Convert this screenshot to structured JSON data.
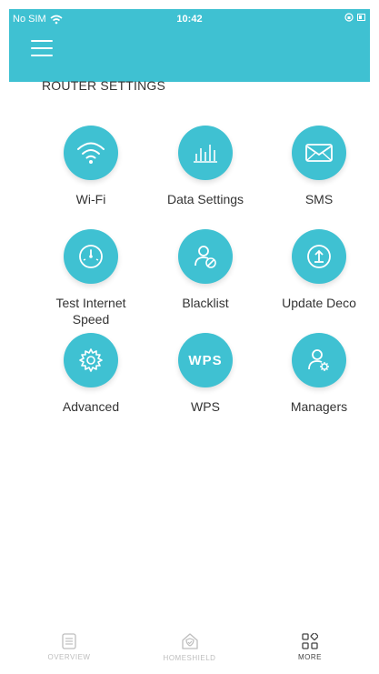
{
  "theme": {
    "accent": "#3fc1d2"
  },
  "status_bar": {
    "carrier": "No SIM",
    "time": "10:42"
  },
  "section_title": "ROUTER SETTINGS",
  "tiles": [
    {
      "label": "Wi-Fi",
      "icon": "wifi-icon"
    },
    {
      "label": "Data Settings",
      "icon": "bar-chart-icon"
    },
    {
      "label": "SMS",
      "icon": "envelope-icon"
    },
    {
      "label": "Test Internet Speed",
      "icon": "speedometer-icon"
    },
    {
      "label": "Blacklist",
      "icon": "user-blocked-icon"
    },
    {
      "label": "Update Deco",
      "icon": "upload-icon"
    },
    {
      "label": "Advanced",
      "icon": "gear-icon"
    },
    {
      "label": "WPS",
      "icon": "wps-icon"
    },
    {
      "label": "Managers",
      "icon": "user-gear-icon"
    }
  ],
  "wps_text": "WPS",
  "bottom_nav": [
    {
      "label": "OVERVIEW",
      "icon": "document-icon",
      "active": false
    },
    {
      "label": "HOMESHIELD",
      "icon": "home-shield-icon",
      "active": false
    },
    {
      "label": "MORE",
      "icon": "grid-icon",
      "active": true
    }
  ]
}
